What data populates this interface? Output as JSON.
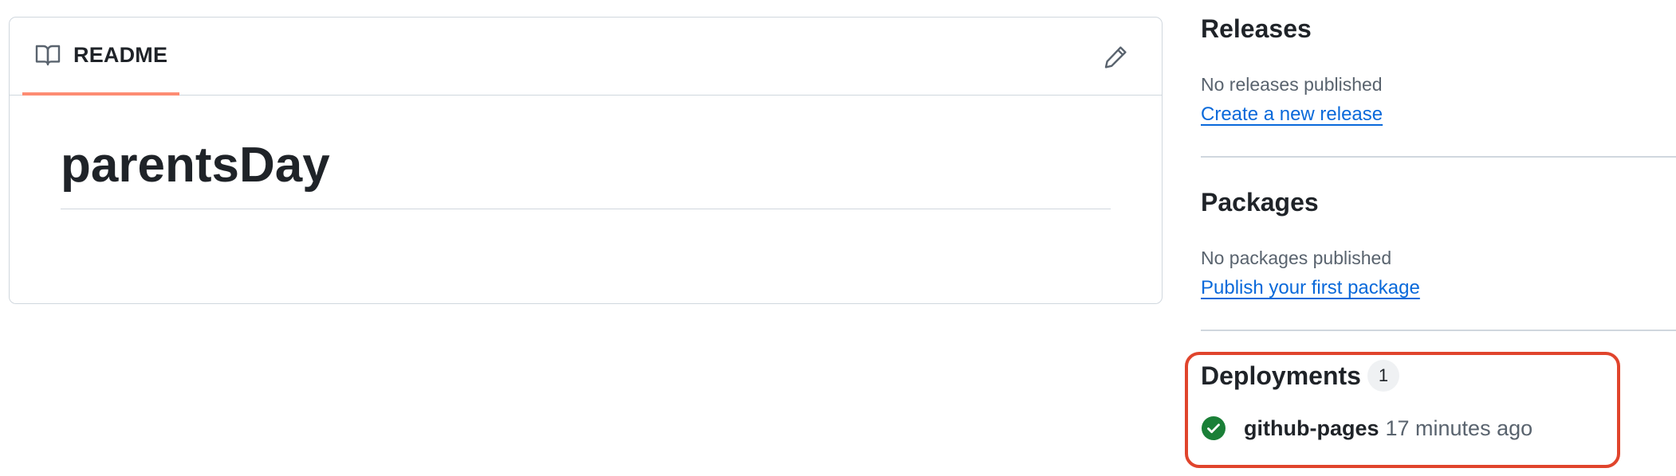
{
  "readme": {
    "tab_label": "README",
    "title": "parentsDay"
  },
  "sidebar": {
    "releases": {
      "title": "Releases",
      "empty_text": "No releases published",
      "link": "Create a new release"
    },
    "packages": {
      "title": "Packages",
      "empty_text": "No packages published",
      "link": "Publish your first package"
    },
    "deployments": {
      "title": "Deployments",
      "count": "1",
      "items": [
        {
          "name": "github-pages",
          "time": "17 minutes ago",
          "status": "success"
        }
      ]
    }
  },
  "colors": {
    "tab_underline": "#fd8c73",
    "link": "#0969da",
    "success": "#1a7f37",
    "highlight": "#e0442c"
  },
  "icons": {
    "readme": "book-icon",
    "edit": "pencil-icon",
    "status": "check-circle-icon"
  }
}
